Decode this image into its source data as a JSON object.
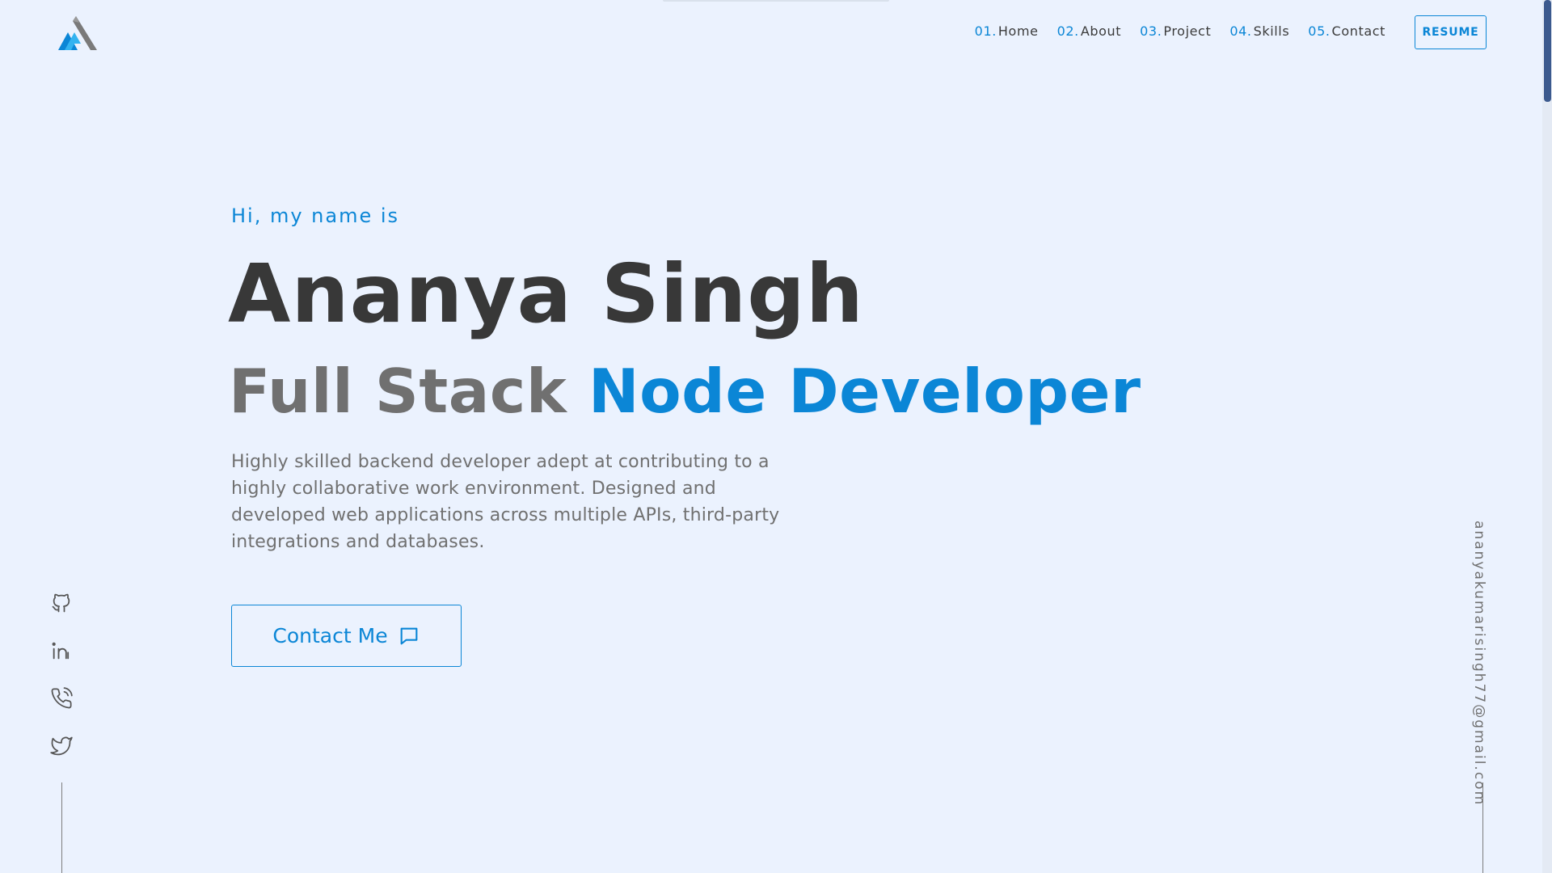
{
  "header": {
    "nav": [
      {
        "num": "01.",
        "label": "Home"
      },
      {
        "num": "02.",
        "label": "About"
      },
      {
        "num": "03.",
        "label": "Project"
      },
      {
        "num": "04.",
        "label": "Skills"
      },
      {
        "num": "05.",
        "label": "Contact"
      }
    ],
    "resume_label": "RESUME"
  },
  "hero": {
    "greeting": "Hi, my name is",
    "name": "Ananya Singh",
    "role_part1": "Full Stack",
    "role_part2": "Node Developer",
    "bio": "Highly skilled backend developer adept at contributing to a highly collaborative work environment. Designed and developed web applications across multiple APIs, third-party integrations and databases.",
    "contact_label": "Contact Me"
  },
  "social": {
    "icons": [
      "github-icon",
      "linkedin-icon",
      "phone-icon",
      "twitter-icon"
    ]
  },
  "email": "ananyakumarisingh77@gmail.com",
  "colors": {
    "accent": "#0b86d6",
    "background": "#ebf2fe",
    "text_dark": "#383838",
    "text_grey": "#707070",
    "scroll_thumb": "#3c5a8e"
  }
}
